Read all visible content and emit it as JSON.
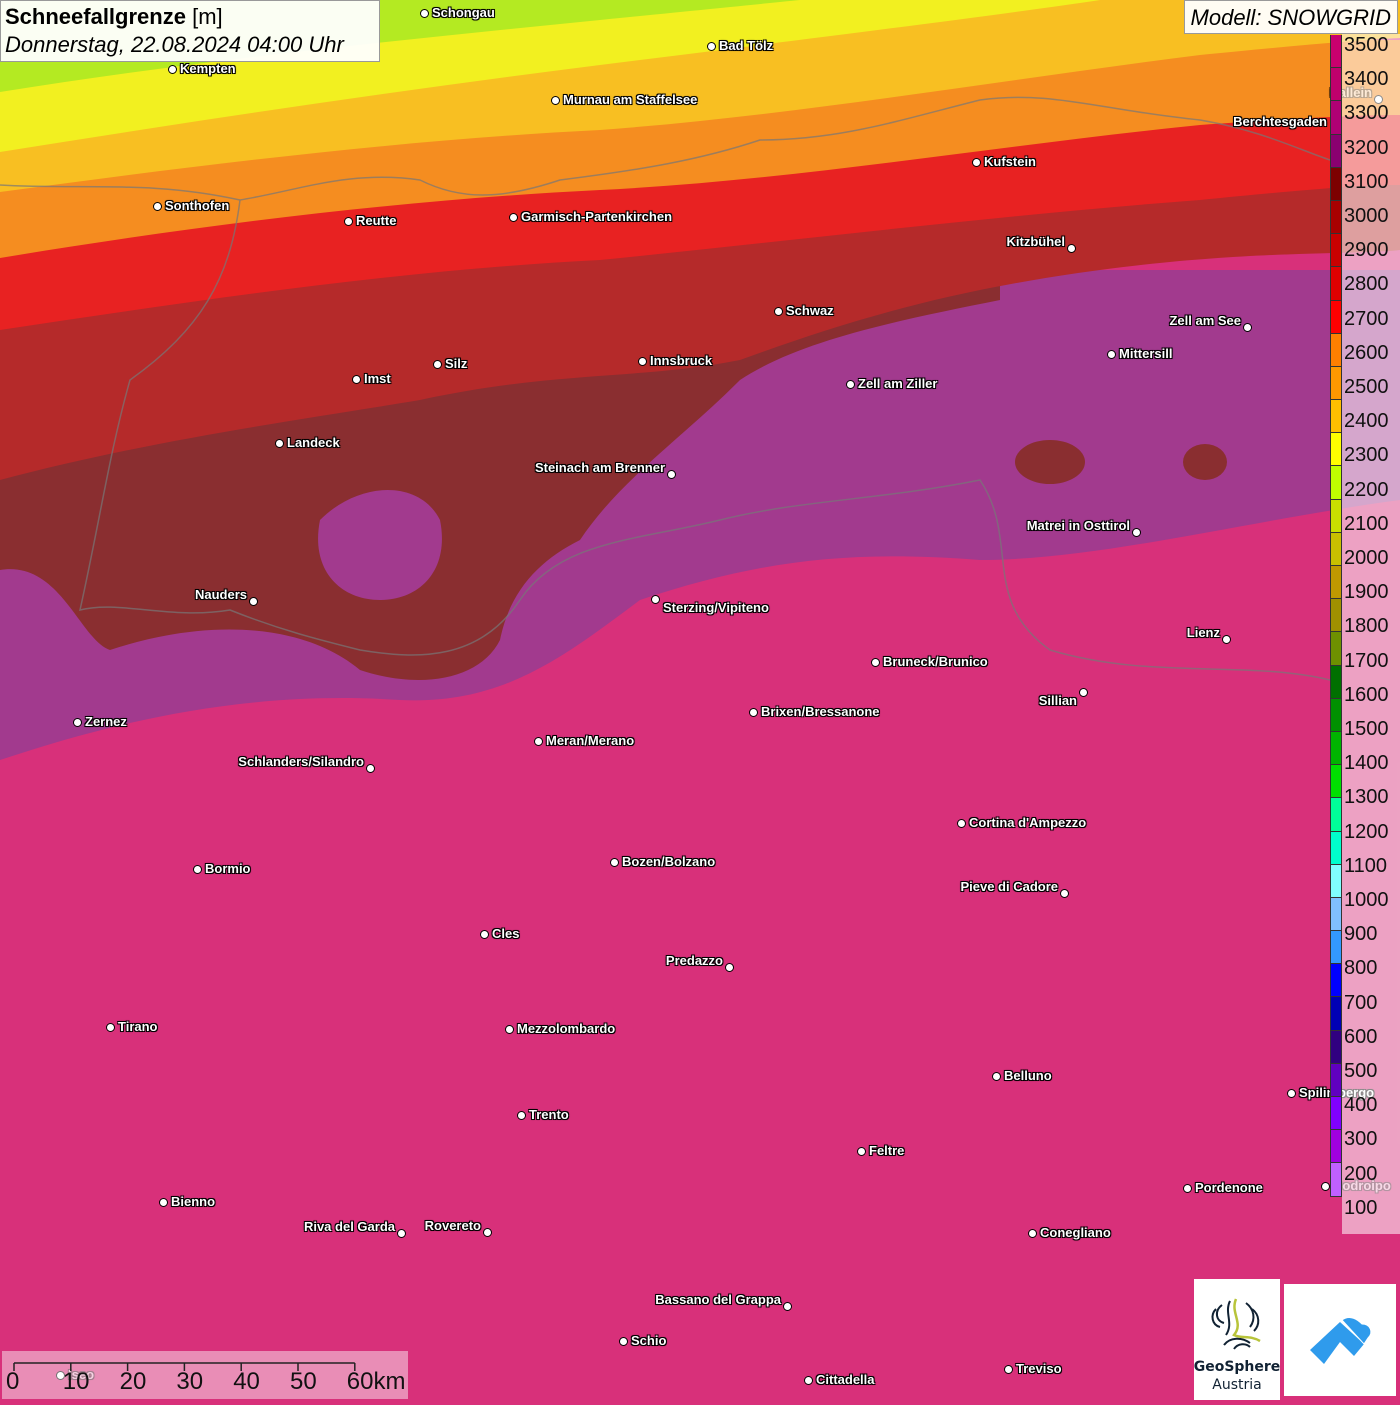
{
  "header": {
    "title": "Schneefallgrenze",
    "unit": "[m]",
    "datetime": "Donnerstag, 22.08.2024 04:00 Uhr",
    "model": "Modell: SNOWGRID"
  },
  "legend": {
    "labels": [
      "3500",
      "3400",
      "3300",
      "3200",
      "3100",
      "3000",
      "2900",
      "2800",
      "2700",
      "2600",
      "2500",
      "2400",
      "2300",
      "2200",
      "2100",
      "2000",
      "1900",
      "1800",
      "1700",
      "1600",
      "1500",
      "1400",
      "1300",
      "1200",
      "1100",
      "1000",
      "900",
      "800",
      "700",
      "600",
      "500",
      "400",
      "300",
      "200",
      "100"
    ],
    "colors": [
      "#c8006e",
      "#c0006c",
      "#b00074",
      "#8a0070",
      "#7c0000",
      "#a80000",
      "#c80000",
      "#e00000",
      "#ff0000",
      "#ff7f00",
      "#ff9800",
      "#ffbf00",
      "#ffff00",
      "#bfff00",
      "#c8e000",
      "#c8c000",
      "#c09800",
      "#a09000",
      "#6e9000",
      "#007000",
      "#009000",
      "#00b400",
      "#00e000",
      "#00ff99",
      "#00ffcc",
      "#80ffff",
      "#80c0ff",
      "#3399ff",
      "#0000ff",
      "#0000b4",
      "#300080",
      "#6000c0",
      "#8000ff",
      "#a000e0",
      "#c060ff"
    ]
  },
  "cities": [
    "Schongau",
    "Bad Tölz",
    "Kempten",
    "Murnau am Staffelsee",
    "Sonthofen",
    "Reutte",
    "Garmisch-Partenkirchen",
    "Kufstein",
    "Berchtesgaden",
    "Hallein",
    "Kitzbühel",
    "Schwaz",
    "Zell am See",
    "Mittersill",
    "Innsbruck",
    "Silz",
    "Imst",
    "Zell am Ziller",
    "Landeck",
    "Steinach am Brenner",
    "Matrei in Osttirol",
    "Nauders",
    "Sterzing/Vipiteno",
    "Lienz",
    "Bruneck/Brunico",
    "Sillian",
    "Brixen/Bressanone",
    "Zernez",
    "Meran/Merano",
    "Schlanders/Silandro",
    "Cortina d'Ampezzo",
    "Bozen/Bolzano",
    "Bormio",
    "Pieve di Cadore",
    "Cles",
    "Predazzo",
    "Tirano",
    "Mezzolombardo",
    "Belluno",
    "Spilimbergo",
    "Trento",
    "Feltre",
    "Pordenone",
    "Codroipo",
    "Bienno",
    "Riva del Garda",
    "Rovereto",
    "Conegliano",
    "Bassano del Grappa",
    "Schio",
    "Treviso",
    "Cittadella",
    "Iseo"
  ],
  "scale_bar": {
    "labels": [
      "0",
      "10",
      "20",
      "30",
      "40",
      "50",
      "60km"
    ]
  },
  "logos": {
    "geosphere": "GeoSphere Austria",
    "geosphere_line1": "GeoSphere",
    "geosphere_line2": "Austria"
  },
  "map_colors": {
    "background": "#d8307a",
    "purple_zone": "#a03a90",
    "brown_zone": "#8a2e30"
  }
}
